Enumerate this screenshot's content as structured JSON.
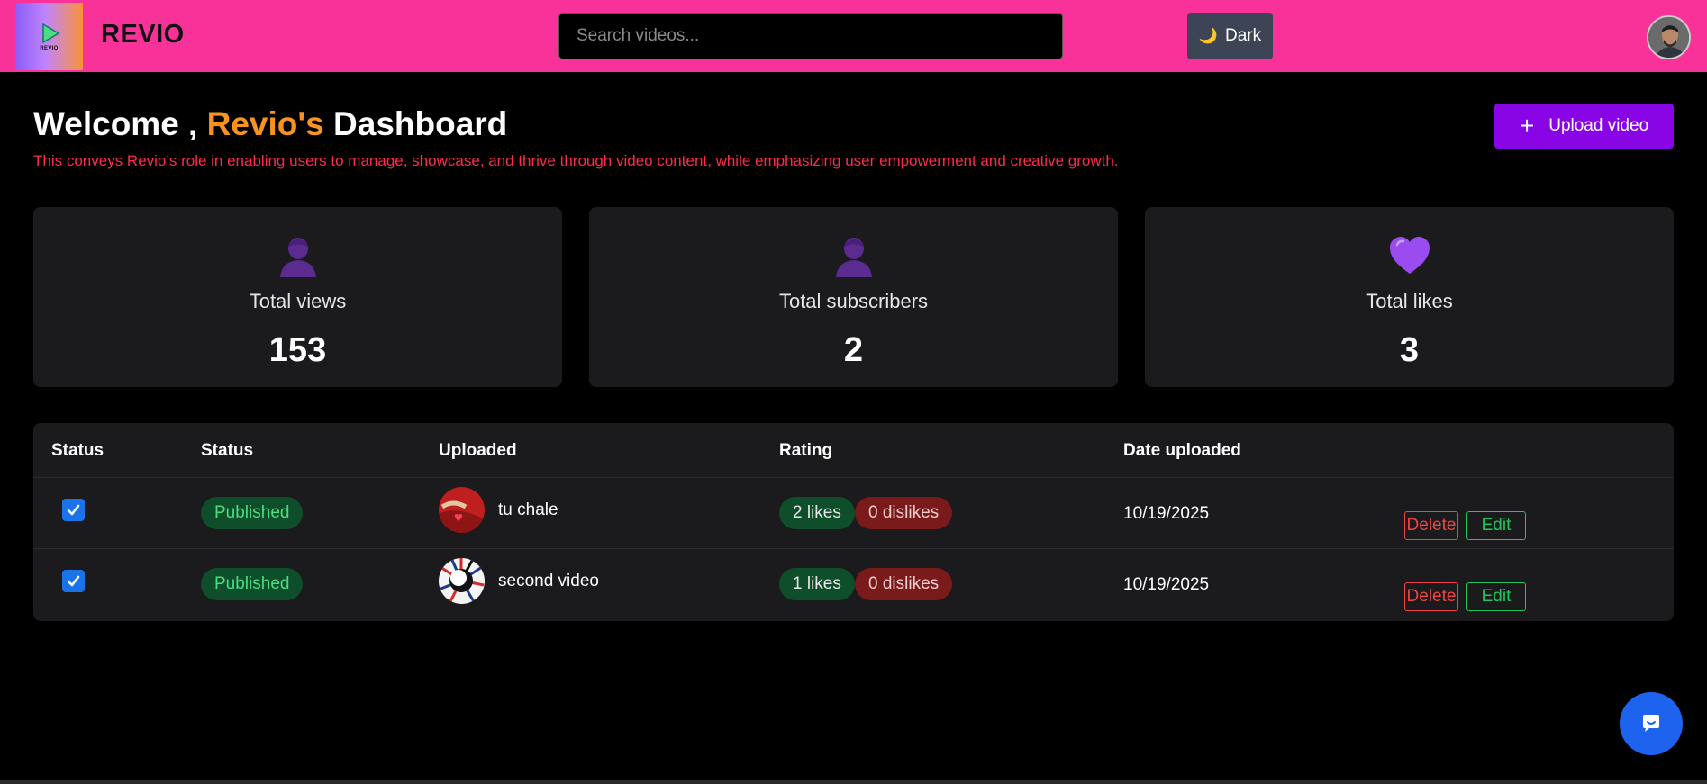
{
  "header": {
    "logo_small_text": "REVIO",
    "brand": "REVIO",
    "search_placeholder": "Search videos...",
    "theme_toggle": {
      "icon": "moon-icon",
      "label": "Dark"
    },
    "avatar": "user-avatar"
  },
  "welcome": {
    "prefix": "Welcome ,",
    "accent": "Revio's",
    "suffix": "Dashboard",
    "subtitle": "This conveys Revio’s role in enabling users to manage, showcase, and thrive through video content, while emphasizing user empowerment and creative growth.",
    "accent_color": "#f7931e"
  },
  "upload_button": {
    "icon": "plus-icon",
    "label": "Upload video"
  },
  "stats": [
    {
      "icon": "user-icon",
      "label": "Total views",
      "value": "153"
    },
    {
      "icon": "user-icon",
      "label": "Total subscribers",
      "value": "2"
    },
    {
      "icon": "heart-icon",
      "label": "Total likes",
      "value": "3"
    }
  ],
  "table": {
    "headers": [
      "Status",
      "Status",
      "Uploaded",
      "Rating",
      "Date uploaded"
    ],
    "rows": [
      {
        "checked": true,
        "status": "Published",
        "title": "tu chale",
        "likes": "2 likes",
        "dislikes": "0 dislikes",
        "date": "10/19/2025",
        "delete": "Delete",
        "edit": "Edit"
      },
      {
        "checked": true,
        "status": "Published",
        "title": "second video",
        "likes": "1 likes",
        "dislikes": "0 dislikes",
        "date": "10/19/2025",
        "delete": "Delete",
        "edit": "Edit"
      }
    ]
  },
  "colors": {
    "header_bg": "#f9329a",
    "upload_button": "#8a05e6",
    "published": "#4ade80",
    "delete": "#ef4444",
    "edit": "#22c55e",
    "subtitle": "#ff2a4a"
  },
  "chat_button": {
    "icon": "chat-icon"
  }
}
